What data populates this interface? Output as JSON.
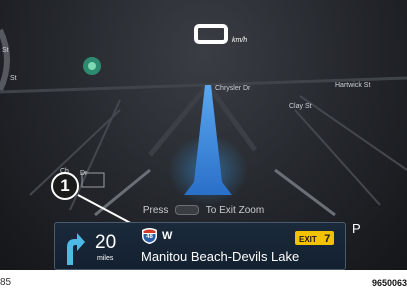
{
  "speed": {
    "value_glyph": "O",
    "unit": "km/h"
  },
  "map": {
    "streets": [
      "St",
      "St",
      "Chrysler Dr",
      "Hartwick St",
      "Clay St",
      "Ch",
      "Dr"
    ]
  },
  "hint": {
    "press": "Press",
    "action": "To Exit Zoom"
  },
  "banner": {
    "distance": "20",
    "distance_unit": "miles",
    "route_shield": "48",
    "direction": "W",
    "exit_label": "EXIT",
    "exit_number": "7",
    "destination": "Manitou Beach-Devils Lake"
  },
  "gear": "P",
  "callout": "1",
  "footer": {
    "page": "85",
    "code": "9650063"
  },
  "colors": {
    "route": "#3a8fe0",
    "turn_arrow": "#4fb9e6",
    "exit_badge": "#f2c200",
    "shield": "#2c5ea8"
  }
}
